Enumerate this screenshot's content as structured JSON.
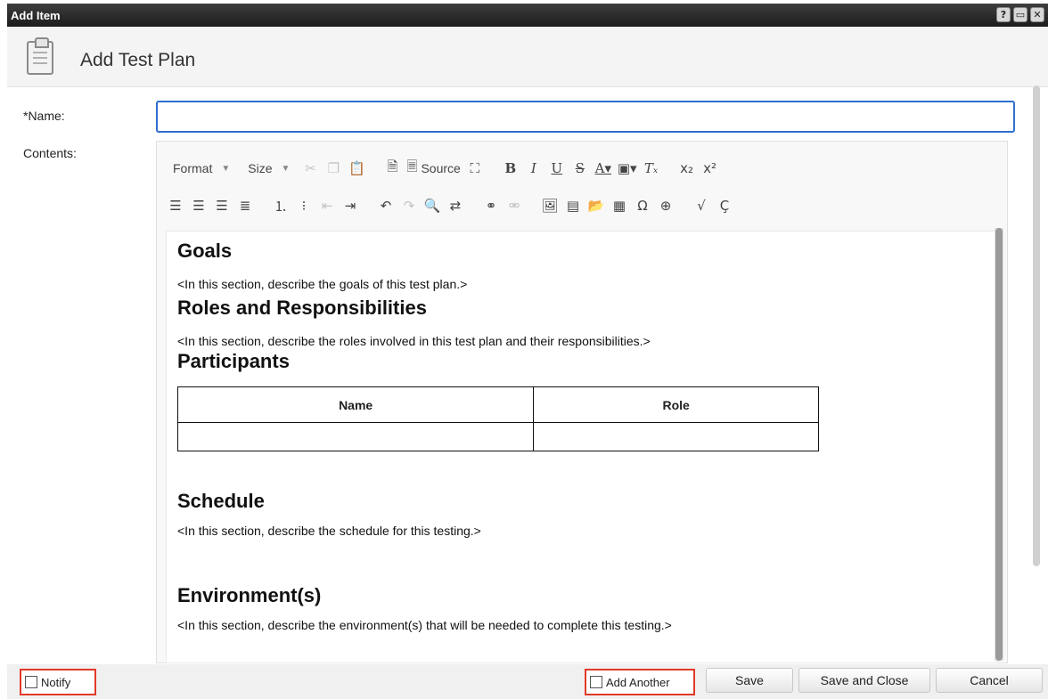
{
  "window": {
    "title": "Add Item",
    "buttons": [
      "?",
      "▭",
      "✕"
    ]
  },
  "header": {
    "title": "Add Test Plan",
    "icon": "clipboard-icon"
  },
  "form": {
    "name_label": "*Name:",
    "name_value": "",
    "contents_label": "Contents:"
  },
  "toolbar": {
    "format_label": "Format",
    "size_label": "Size",
    "source_label": "Source"
  },
  "document": {
    "goals_heading": "Goals",
    "goals_text": "<In this section, describe the goals of this test plan.>",
    "roles_heading": "Roles and Responsibilities",
    "roles_text": "<In this section, describe the roles involved in this test plan and their responsibilities.>",
    "participants_heading": "Participants",
    "table_headers": [
      "Name",
      "Role"
    ],
    "schedule_heading": "Schedule",
    "schedule_text": "<In this section, describe the schedule for this testing.>",
    "environment_heading": "Environment(s)",
    "environment_text": "<In this section, describe the environment(s) that will be needed to complete this testing.>"
  },
  "footer": {
    "notify_label": "Notify",
    "add_another_label": "Add Another",
    "save_label": "Save",
    "save_close_label": "Save and Close",
    "cancel_label": "Cancel"
  },
  "colors": {
    "highlight": "#e23a2a",
    "focus": "#2e6fd0",
    "titlebar": "#2a2a2a"
  }
}
